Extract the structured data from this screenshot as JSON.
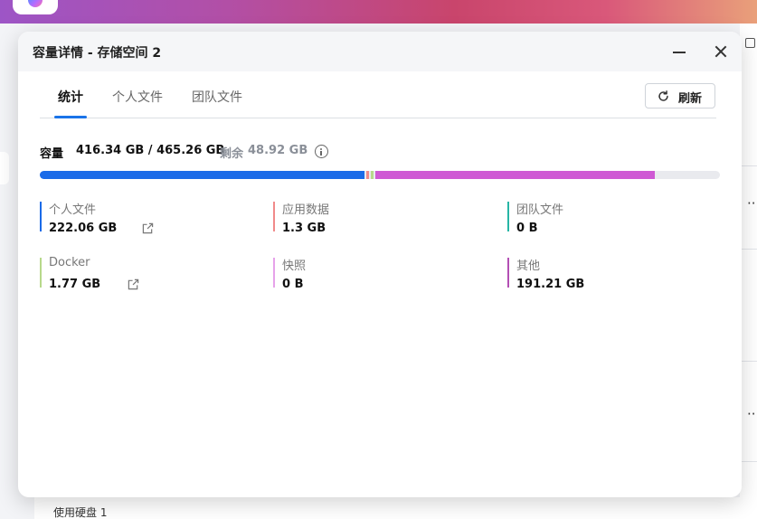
{
  "dialog": {
    "title": "容量详情 - 存储空间 2"
  },
  "tabs": [
    {
      "label": "统计",
      "active": true
    },
    {
      "label": "个人文件",
      "active": false
    },
    {
      "label": "团队文件",
      "active": false
    }
  ],
  "refresh": {
    "label": "刷新",
    "icon": "refresh-icon"
  },
  "capacity": {
    "label": "容量",
    "used_total": "416.34 GB / 465.26 GB",
    "free_label": "剩余",
    "free_value": "48.92 GB",
    "info_icon": "info-icon"
  },
  "usage_bar": {
    "total_gb": 465.26,
    "segments": [
      {
        "name": "个人文件",
        "gb": 222.06,
        "color": "#1a6be8"
      },
      {
        "name": "应用数据",
        "gb": 1.3,
        "color": "#f08a8a"
      },
      {
        "name": "Docker",
        "gb": 1.77,
        "color": "#b7d98b"
      },
      {
        "name": "其他",
        "gb": 191.21,
        "color": "#cf59d4"
      }
    ],
    "track_color": "#e9eaee"
  },
  "stats": [
    {
      "name": "个人文件",
      "value": "222.06 GB",
      "color": "#1a6be8",
      "link": true
    },
    {
      "name": "应用数据",
      "value": "1.3 GB",
      "color": "#f08a8a",
      "link": false
    },
    {
      "name": "团队文件",
      "value": "0 B",
      "color": "#27b5a5",
      "link": false
    },
    {
      "name": "Docker",
      "value": "1.77 GB",
      "color": "#b7d98b",
      "link": true
    },
    {
      "name": "快照",
      "value": "0 B",
      "color": "#e6a2ea",
      "link": false
    },
    {
      "name": "其他",
      "value": "191.21 GB",
      "color": "#b34fb4",
      "link": false
    }
  ],
  "background": {
    "bottom_text": "使用硬盘 1",
    "more_glyph": "···"
  }
}
